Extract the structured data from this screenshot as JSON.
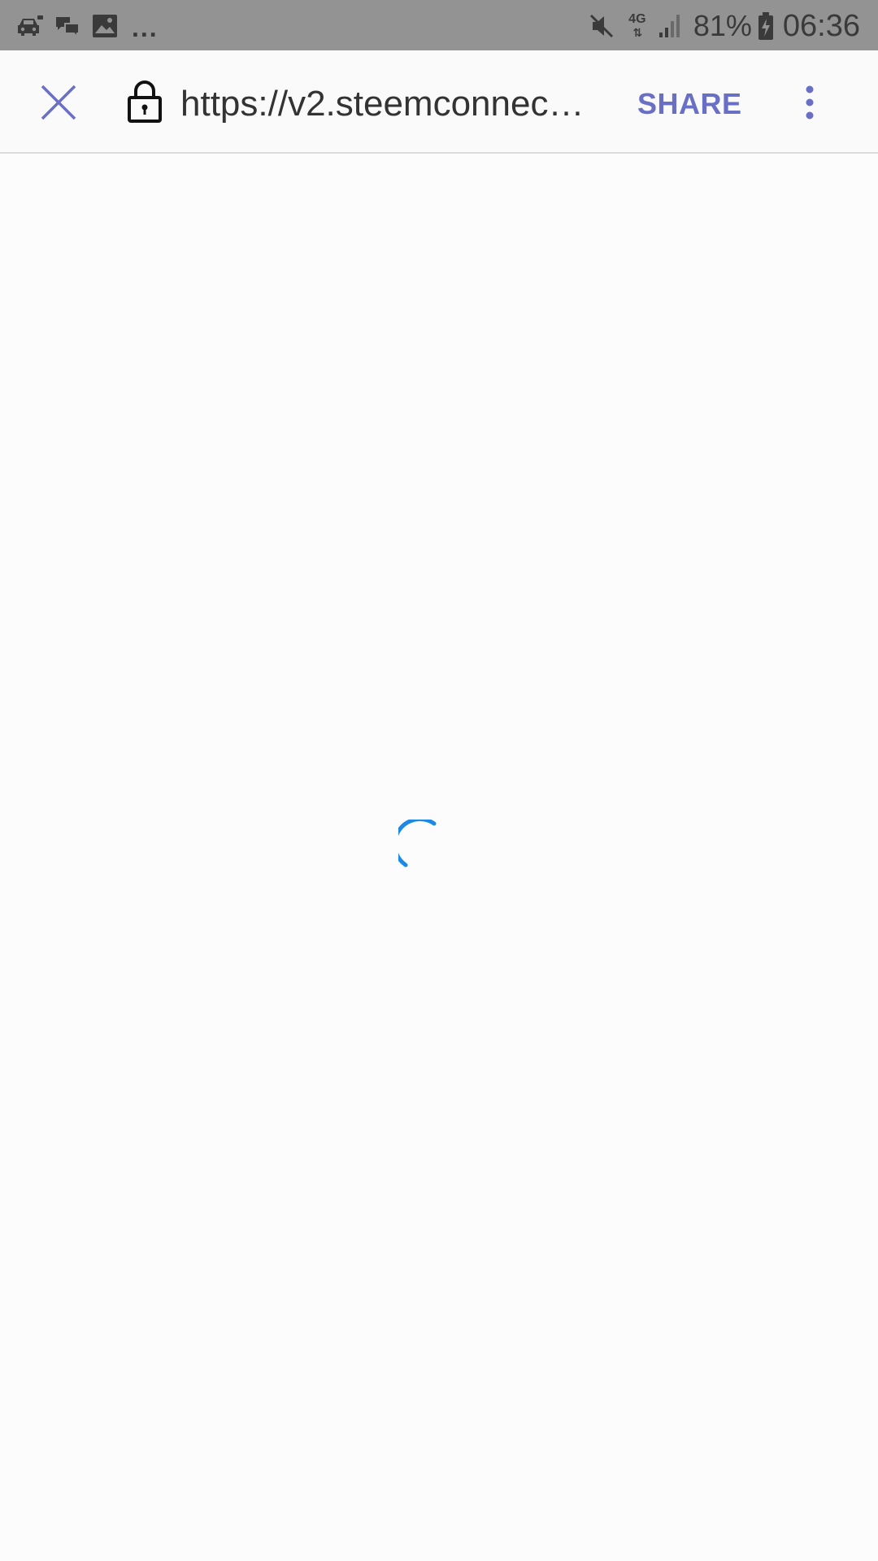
{
  "status_bar": {
    "notification_icons": [
      "car-icon",
      "chat-icon",
      "image-icon"
    ],
    "more_indicator": "...",
    "network_type": "4G",
    "battery_percent": "81%",
    "time": "06:36"
  },
  "toolbar": {
    "url": "https://v2.steemconnect.c…",
    "share_label": "SHARE",
    "accent_color": "#6a6fc6"
  },
  "content": {
    "state": "loading",
    "spinner_color": "#1e88e5"
  }
}
